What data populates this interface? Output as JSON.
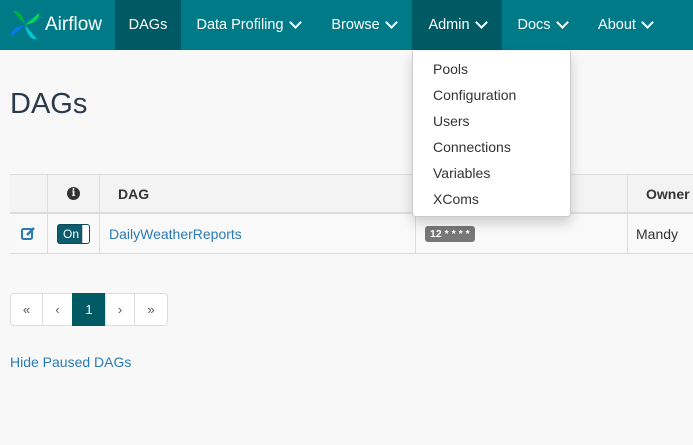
{
  "brand": {
    "name": "Airflow"
  },
  "nav": {
    "items": [
      {
        "label": "DAGs",
        "dropdown": false
      },
      {
        "label": "Data Profiling",
        "dropdown": true
      },
      {
        "label": "Browse",
        "dropdown": true
      },
      {
        "label": "Admin",
        "dropdown": true
      },
      {
        "label": "Docs",
        "dropdown": true
      },
      {
        "label": "About",
        "dropdown": true
      }
    ],
    "active": "DAGs",
    "open": "Admin"
  },
  "admin_menu": {
    "items": [
      "Pools",
      "Configuration",
      "Users",
      "Connections",
      "Variables",
      "XComs"
    ]
  },
  "page": {
    "title": "DAGs"
  },
  "table": {
    "headers": {
      "info": "i",
      "dag": "DAG",
      "owner": "Owner"
    },
    "rows": [
      {
        "toggle": "On",
        "dag": "DailyWeatherReports",
        "schedule": "12 * * * *",
        "owner": "Mandy"
      }
    ]
  },
  "pagination": {
    "first": "«",
    "prev": "‹",
    "current": "1",
    "next": "›",
    "last": "»"
  },
  "footer": {
    "hide_paused": "Hide Paused DAGs"
  },
  "colors": {
    "navbar": "#007a87",
    "nav_active": "#005a64",
    "link": "#2a7bb4"
  }
}
